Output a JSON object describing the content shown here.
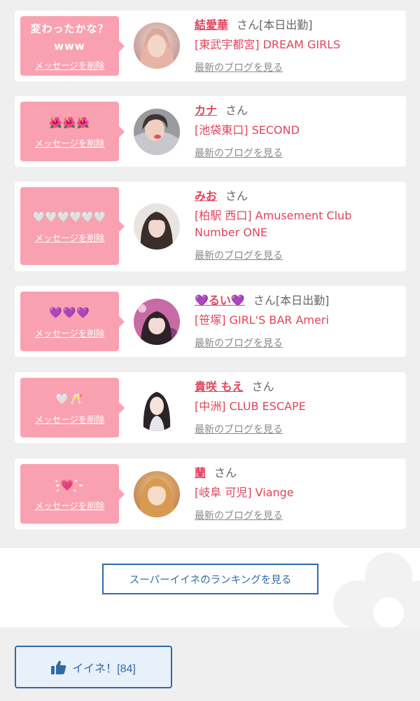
{
  "messages": [
    {
      "bubble": "変わったかな？\nwww",
      "delete_label": "メッセージを削除",
      "name": "結愛華",
      "suffix": "さん[本日出勤]",
      "shop": "[東武宇都宮] DREAM GIRLS",
      "blog_label": "最新のブログを見る",
      "avatar": "avatar-woman-selfie"
    },
    {
      "bubble": "🌺🌺🌺",
      "delete_label": "メッセージを削除",
      "name": "カナ",
      "suffix": "さん",
      "shop": "[池袋東口] SECOND",
      "blog_label": "最新のブログを見る",
      "avatar": "avatar-woman-hood"
    },
    {
      "bubble": "🤍🤍🤍🤍🤍🤍",
      "delete_label": "メッセージを削除",
      "name": "みお",
      "suffix": "さん",
      "shop": "[柏駅 西口] Amusement Club Number ONE",
      "blog_label": "最新のブログを見る",
      "avatar": "avatar-woman-portrait"
    },
    {
      "bubble": "💜💜💜",
      "delete_label": "メッセージを削除",
      "name": "💜るい💜",
      "suffix": "さん[本日出勤]",
      "shop": "[笹塚] GIRL'S BAR Ameri",
      "blog_label": "最新のブログを見る",
      "avatar": "avatar-woman-pink"
    },
    {
      "bubble": "🤍🥂",
      "delete_label": "メッセージを削除",
      "name": "貴咲 もえ",
      "suffix": "さん",
      "shop": "[中洲] CLUB ESCAPE",
      "blog_label": "最新のブログを見る",
      "avatar": "avatar-woman-dress"
    },
    {
      "bubble": "-̗̀💗 ̖́-",
      "delete_label": "メッセージを削除",
      "name": "蘭",
      "suffix": "さん",
      "shop": "[岐阜 可児] Viange",
      "blog_label": "最新のブログを見る",
      "avatar": "avatar-woman-blonde"
    }
  ],
  "ranking_button": "スーパーイイネのランキングを見る",
  "like_button": "イイネ！[84]",
  "like_icon": "thumbs-up-icon",
  "colors": {
    "bubble": "#f9a1b0",
    "name": "#e0445b",
    "link_blue": "#2f6ca6"
  }
}
